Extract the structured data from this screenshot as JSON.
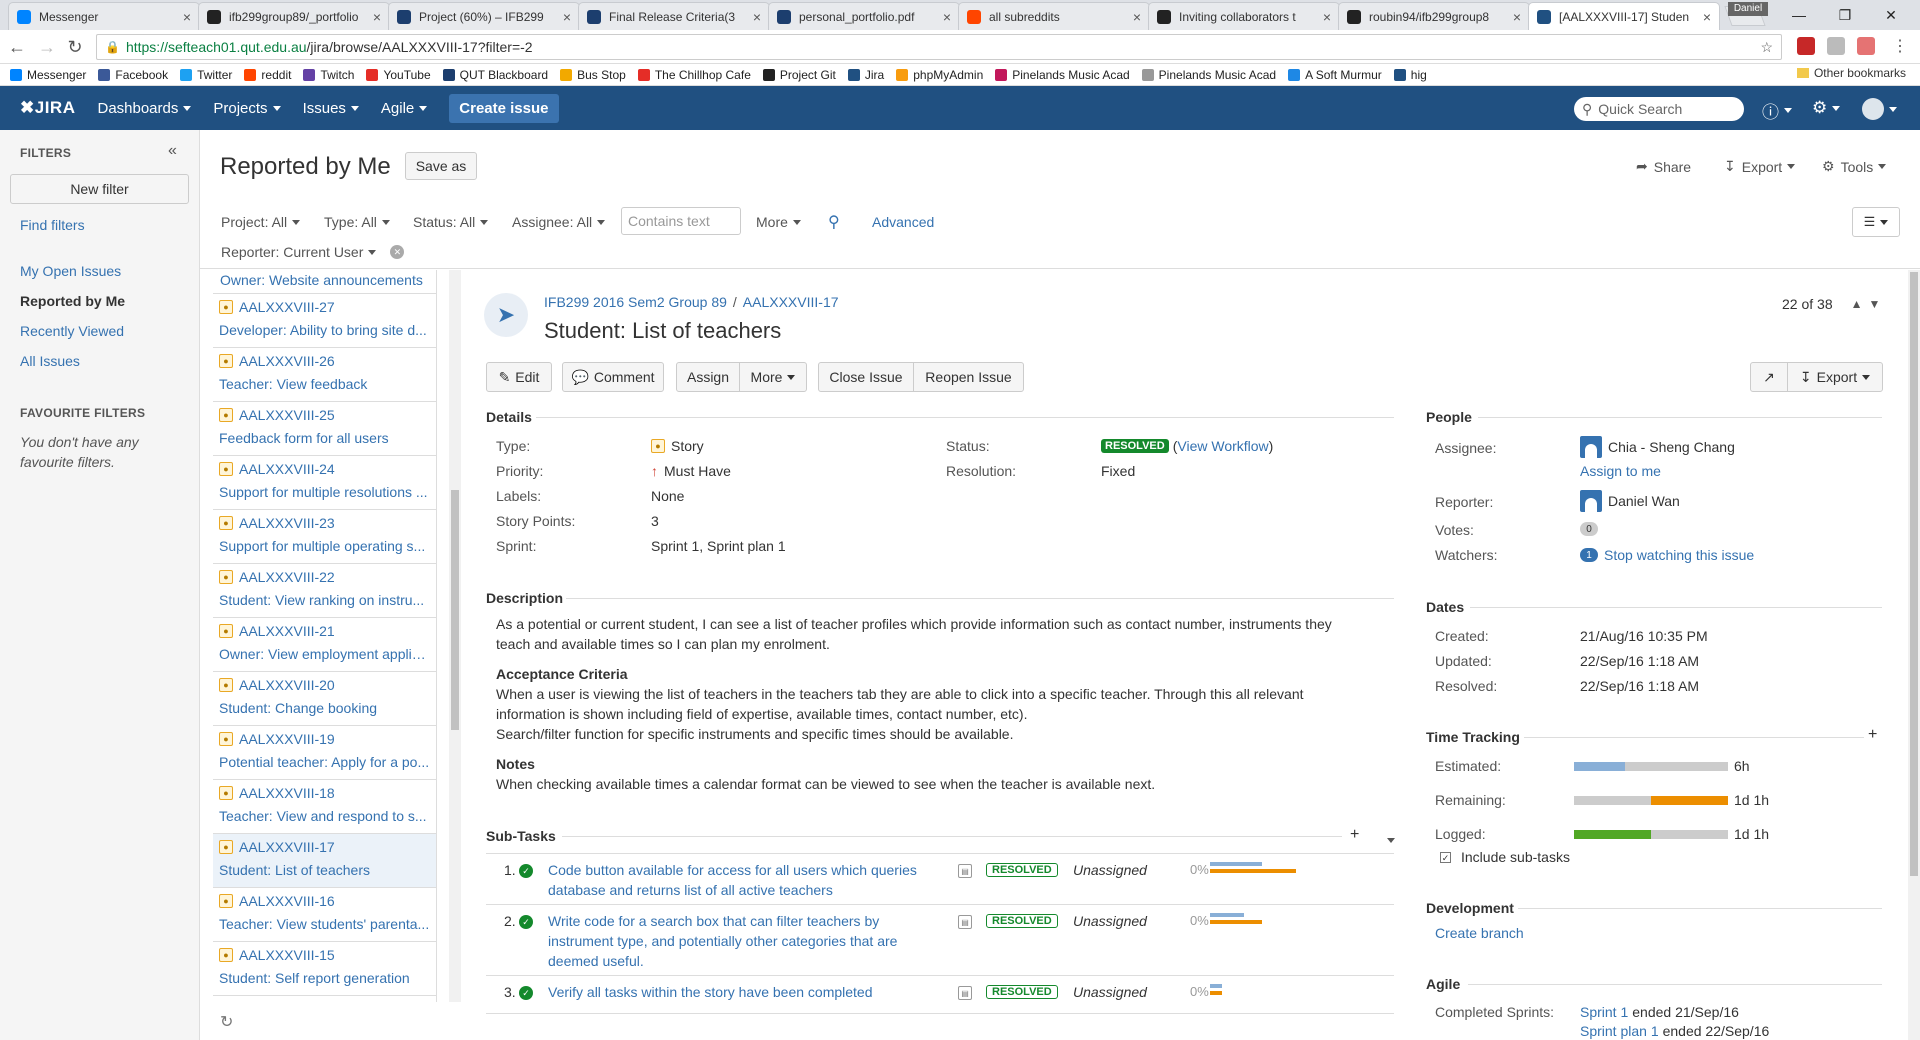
{
  "browser": {
    "tabs": [
      {
        "title": "Messenger",
        "icon": "messenger-icon",
        "color": "#0084ff",
        "active": false
      },
      {
        "title": "ifb299group89/_portfolio",
        "icon": "github-icon",
        "color": "#222222",
        "active": false
      },
      {
        "title": "Project (60%) – IFB299",
        "icon": "qut-icon",
        "color": "#1c3e6e",
        "active": false
      },
      {
        "title": "Final Release Criteria(3",
        "icon": "qut-icon",
        "color": "#1c3e6e",
        "active": false
      },
      {
        "title": "personal_portfolio.pdf",
        "icon": "qut-icon",
        "color": "#1c3e6e",
        "active": false
      },
      {
        "title": "all subreddits",
        "icon": "reddit-icon",
        "color": "#ff4500",
        "active": false
      },
      {
        "title": "Inviting collaborators t",
        "icon": "github-icon",
        "color": "#222222",
        "active": false
      },
      {
        "title": "roubin94/ifb299group8",
        "icon": "github-icon",
        "color": "#222222",
        "active": false
      },
      {
        "title": "[AALXXXVIII-17] Studen",
        "icon": "jira-icon",
        "color": "#205081",
        "active": true
      }
    ],
    "profile_name": "Daniel",
    "url_domain": "https://sefteach01.qut.edu.au",
    "url_path": "/jira/browse/AALXXXVIII-17?filter=-2",
    "bookmarks": [
      {
        "label": "Messenger",
        "icon": "messenger-icon",
        "color": "#0084ff"
      },
      {
        "label": "Facebook",
        "icon": "facebook-icon",
        "color": "#3b5998"
      },
      {
        "label": "Twitter",
        "icon": "twitter-icon",
        "color": "#1da1f2"
      },
      {
        "label": "reddit",
        "icon": "reddit-icon",
        "color": "#ff4500"
      },
      {
        "label": "Twitch",
        "icon": "twitch-icon",
        "color": "#6441a5"
      },
      {
        "label": "YouTube",
        "icon": "youtube-icon",
        "color": "#e52d27"
      },
      {
        "label": "QUT Blackboard",
        "icon": "qut-icon",
        "color": "#1c3e6e"
      },
      {
        "label": "Bus Stop",
        "icon": "bus-icon",
        "color": "#f2a900"
      },
      {
        "label": "The Chillhop Cafe",
        "icon": "youtube-icon",
        "color": "#e52d27"
      },
      {
        "label": "Project Git",
        "icon": "github-icon",
        "color": "#222222"
      },
      {
        "label": "Jira",
        "icon": "jira-icon",
        "color": "#205081"
      },
      {
        "label": "phpMyAdmin",
        "icon": "phpmyadmin-icon",
        "color": "#f89c0e"
      },
      {
        "label": "Pinelands Music Acad",
        "icon": "pinelands-icon",
        "color": "#c2185b"
      },
      {
        "label": "Pinelands Music Acad",
        "icon": "page-icon",
        "color": "#999999"
      },
      {
        "label": "A Soft Murmur",
        "icon": "droplet-icon",
        "color": "#1e88e5"
      },
      {
        "label": "hig",
        "icon": "jira-icon",
        "color": "#205081"
      }
    ],
    "other_bookmarks": "Other bookmarks"
  },
  "jira_header": {
    "logo": "JIRA",
    "nav": [
      "Dashboards",
      "Projects",
      "Issues",
      "Agile"
    ],
    "create": "Create issue",
    "search_placeholder": "Quick Search"
  },
  "sidebar": {
    "filters_heading": "FILTERS",
    "new_filter": "New filter",
    "find_filters": "Find filters",
    "links": [
      "My Open Issues",
      "Reported by Me",
      "Recently Viewed",
      "All Issues"
    ],
    "favourite_heading": "FAVOURITE FILTERS",
    "favourite_empty": "You don't have any favourite filters."
  },
  "page": {
    "title": "Reported by Me",
    "save_as": "Save as",
    "share": "Share",
    "export": "Export",
    "tools": "Tools"
  },
  "filterbar": {
    "project": "Project: All",
    "type": "Type: All",
    "status": "Status: All",
    "assignee": "Assignee: All",
    "contains_placeholder": "Contains text",
    "more": "More",
    "advanced": "Advanced",
    "reporter": "Reporter: Current User"
  },
  "issue_list": {
    "first_partial": "Owner: Website announcements",
    "items": [
      {
        "key": "AALXXXVIII-27",
        "summary": "Developer: Ability to bring site d..."
      },
      {
        "key": "AALXXXVIII-26",
        "summary": "Teacher: View feedback"
      },
      {
        "key": "AALXXXVIII-25",
        "summary": "Feedback form for all users"
      },
      {
        "key": "AALXXXVIII-24",
        "summary": "Support for multiple resolutions ..."
      },
      {
        "key": "AALXXXVIII-23",
        "summary": "Support for multiple operating s..."
      },
      {
        "key": "AALXXXVIII-22",
        "summary": "Student: View ranking on instru..."
      },
      {
        "key": "AALXXXVIII-21",
        "summary": "Owner: View employment applic..."
      },
      {
        "key": "AALXXXVIII-20",
        "summary": "Student: Change booking"
      },
      {
        "key": "AALXXXVIII-19",
        "summary": "Potential teacher: Apply for a po..."
      },
      {
        "key": "AALXXXVIII-18",
        "summary": "Teacher: View and respond to s..."
      },
      {
        "key": "AALXXXVIII-17",
        "summary": "Student: List of teachers",
        "selected": true
      },
      {
        "key": "AALXXXVIII-16",
        "summary": "Teacher: View students' parenta..."
      },
      {
        "key": "AALXXXVIII-15",
        "summary": "Student: Self report generation"
      }
    ]
  },
  "issue": {
    "project": "IFB299 2016 Sem2 Group 89",
    "key": "AALXXXVIII-17",
    "title": "Student: List of teachers",
    "pager": "22 of 38",
    "toolbar": {
      "edit": "Edit",
      "comment": "Comment",
      "assign": "Assign",
      "more": "More",
      "close": "Close Issue",
      "reopen": "Reopen Issue",
      "export": "Export"
    },
    "details_heading": "Details",
    "details": {
      "type_label": "Type:",
      "type": "Story",
      "priority_label": "Priority:",
      "priority": "Must Have",
      "labels_label": "Labels:",
      "labels": "None",
      "points_label": "Story Points:",
      "points": "3",
      "sprint_label": "Sprint:",
      "sprint": "Sprint 1, Sprint plan 1",
      "status_label": "Status:",
      "status": "RESOLVED",
      "view_workflow": "View Workflow",
      "resolution_label": "Resolution:",
      "resolution": "Fixed"
    },
    "description_heading": "Description",
    "description_1": "As a potential or current student, I can see a list of teacher profiles which provide information such as contact number, instruments they",
    "description_2": "teach and available times so I can plan my enrolment.",
    "acceptance_heading": "Acceptance Criteria",
    "acceptance_1": "When a user is viewing the list of teachers in the teachers tab they are able to click into a specific teacher. Through this all relevant",
    "acceptance_2": "information is shown including field of expertise, available times, contact number, etc).",
    "acceptance_3": "Search/filter function for specific instruments and specific times should be available.",
    "notes_heading": "Notes",
    "notes": "When checking available times a calendar format can be viewed to see when the teacher is available next.",
    "subtasks_heading": "Sub-Tasks",
    "subtasks": [
      {
        "num": "1.",
        "line1": "Code button available for access for all users which queries",
        "line2": "database and returns list of all active teachers",
        "line3": "",
        "status": "RESOLVED",
        "assignee": "Unassigned",
        "pct": "0%"
      },
      {
        "num": "2.",
        "line1": "Write code for a search box that can filter teachers by",
        "line2": "instrument type, and potentially other categories that are",
        "line3": "deemed useful.",
        "status": "RESOLVED",
        "assignee": "Unassigned",
        "pct": "0%"
      },
      {
        "num": "3.",
        "line1": "Verify all tasks within the story have been completed",
        "line2": "",
        "line3": "",
        "status": "RESOLVED",
        "assignee": "Unassigned",
        "pct": "0%"
      }
    ]
  },
  "people": {
    "heading": "People",
    "assignee_label": "Assignee:",
    "assignee": "Chia - Sheng Chang",
    "assign_to_me": "Assign to me",
    "reporter_label": "Reporter:",
    "reporter": "Daniel Wan",
    "votes_label": "Votes:",
    "votes": "0",
    "watchers_label": "Watchers:",
    "watchers": "1",
    "stop_watching": "Stop watching this issue"
  },
  "dates": {
    "heading": "Dates",
    "created_label": "Created:",
    "created": "21/Aug/16 10:35 PM",
    "updated_label": "Updated:",
    "updated": "22/Sep/16 1:18 AM",
    "resolved_label": "Resolved:",
    "resolved": "22/Sep/16 1:18 AM"
  },
  "time_tracking": {
    "heading": "Time Tracking",
    "estimated_label": "Estimated:",
    "estimated": "6h",
    "estimated_fill": 0.33,
    "remaining_label": "Remaining:",
    "remaining": "1d 1h",
    "remaining_fill": 0.5,
    "logged_label": "Logged:",
    "logged": "1d 1h",
    "logged_fill": 0.5,
    "include_subtasks": "Include sub-tasks",
    "colors": {
      "estimated": "#89afd7",
      "remaining": "#ec8e00",
      "logged": "#51a825",
      "track": "#cccccc"
    }
  },
  "development": {
    "heading": "Development",
    "create_branch": "Create branch"
  },
  "agile": {
    "heading": "Agile",
    "completed_label": "Completed Sprints:",
    "sprint1": "Sprint 1",
    "sprint1_end": "ended 21/Sep/16",
    "sprint2": "Sprint plan 1",
    "sprint2_end": "ended 22/Sep/16"
  }
}
